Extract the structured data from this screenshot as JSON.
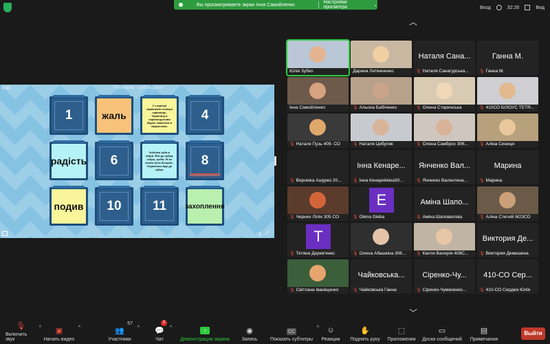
{
  "top": {
    "banner_text": "Вы просматриваете экран Інна Самойленко",
    "view_options": "Настройки просмотра",
    "login": "Вход",
    "time": "32:26",
    "view": "Вид"
  },
  "screen": {
    "timer": "0:30",
    "faint_title": "Тренируем - шоб выдрати",
    "tiles": [
      {
        "text": "1",
        "style": "dark"
      },
      {
        "text": "жаль",
        "style": "orange"
      },
      {
        "text": "У сторінки чарівників четверо чарівниць. Чарівниці в чарівницьктиви Відніх знаютися в мафиетами.",
        "style": "yellow-small"
      },
      {
        "text": "4",
        "style": "dark"
      },
      {
        "text": "радість",
        "style": "cyan"
      },
      {
        "text": "6",
        "style": "dark"
      },
      {
        "text": "Зобоїлм зуби в зебри. Йти до зубра, зебра, треба. Ні не хочеш бути беззубв - Лікуватися йди до зубра.",
        "style": "cyan-small"
      },
      {
        "text": "8",
        "style": "dark-underline"
      },
      {
        "text": "подив",
        "style": "yellow"
      },
      {
        "text": "10",
        "style": "dark"
      },
      {
        "text": "11",
        "style": "dark"
      },
      {
        "text": "захоплення",
        "style": "green"
      }
    ]
  },
  "participants": [
    {
      "name": "Юлія Зубко",
      "big": "",
      "kind": "photo",
      "bg": "#b9c7d6",
      "face": "#e3b48f",
      "muted": false,
      "active": true,
      "hand": true
    },
    {
      "name": "Дарина Литвиненко",
      "big": "",
      "kind": "photo",
      "bg": "#c8b8a2",
      "face": "#f0cfa3",
      "muted": false,
      "active": false
    },
    {
      "name": "Наталя Санагурська...",
      "big": "Наталя Сана...",
      "kind": "text",
      "muted": true
    },
    {
      "name": "Ганна М.",
      "big": "Ганна М.",
      "kind": "text",
      "muted": true
    },
    {
      "name": "Інна Самойленко",
      "big": "",
      "kind": "photo",
      "bg": "#6e5a4b",
      "face": "#d6a27f",
      "muted": false
    },
    {
      "name": "Альона Бабіченко",
      "big": "",
      "kind": "photo",
      "bg": "#b7a18a",
      "face": "#caa48a",
      "muted": true
    },
    {
      "name": "Олена Старинська",
      "big": "",
      "kind": "photo",
      "bg": "#d9cbb3",
      "face": "#f0d8b8",
      "muted": true
    },
    {
      "name": "410СО БІЛОУС ТЕТЯ...",
      "big": "",
      "kind": "photo",
      "bg": "#cfcfd3",
      "face": "#e2b98f",
      "muted": true
    },
    {
      "name": "Наталя Пузь 409- СО",
      "big": "",
      "kind": "photo",
      "bg": "#3a3a3a",
      "face": "#e0a86b",
      "muted": true
    },
    {
      "name": "Наталя Цибуляк",
      "big": "",
      "kind": "photo",
      "bg": "#c7cbd0",
      "face": "#d7b49a",
      "muted": true
    },
    {
      "name": "Олена Самброс 306...",
      "big": "",
      "kind": "photo",
      "bg": "#cfc7bf",
      "face": "#d8b39a",
      "muted": true
    },
    {
      "name": "Аліна Синиця",
      "big": "",
      "kind": "photo",
      "bg": "#b7a07c",
      "face": "#e9c79b",
      "muted": true
    },
    {
      "name": "Вероніка Ашурко 20...",
      "big": "",
      "kind": "blank",
      "muted": true
    },
    {
      "name": "Інна Кенарейкіна30...",
      "big": "Інна Кенаре...",
      "kind": "text",
      "muted": true
    },
    {
      "name": "Янченко Валентина...",
      "big": "Янченко Вал...",
      "kind": "text",
      "muted": true
    },
    {
      "name": "Марина",
      "big": "Марина",
      "kind": "text",
      "muted": true
    },
    {
      "name": "Черних Лілія 305 СО",
      "big": "",
      "kind": "photo",
      "bg": "#5b3b2c",
      "face": "#d2643a",
      "muted": true
    },
    {
      "name": "Olena Gleba",
      "big": "",
      "kind": "avatar",
      "letter": "E",
      "color": "#6a2fc1",
      "muted": true
    },
    {
      "name": "Аміна Шаповалова",
      "big": "Аміна Шапо...",
      "kind": "text",
      "muted": true
    },
    {
      "name": "Аліна Стегній М23СО",
      "big": "",
      "kind": "photo",
      "bg": "#6b5a48",
      "face": "#caa07a",
      "muted": true
    },
    {
      "name": "Тетяна Дерев'янко",
      "big": "",
      "kind": "avatar",
      "letter": "T",
      "color": "#6a2fc1",
      "muted": true
    },
    {
      "name": "Олена Абашкіна 308...",
      "big": "",
      "kind": "photo",
      "bg": "#2f2f2f",
      "face": "#e5c3a8",
      "muted": true
    },
    {
      "name": "Капля Валерія 408С...",
      "big": "",
      "kind": "photo",
      "bg": "#c0b4a5",
      "face": "#e7c6a6",
      "muted": true
    },
    {
      "name": "Виктория Демешина",
      "big": "Виктория Де...",
      "kind": "text",
      "muted": true
    },
    {
      "name": "Світлана Іваніщенко",
      "big": "",
      "kind": "photo",
      "bg": "#3b5f3a",
      "face": "#e7a46e",
      "muted": true
    },
    {
      "name": "Чайковська Ганна",
      "big": "Чайковська...",
      "kind": "text",
      "muted": true
    },
    {
      "name": "Сіренко-Чумаченко...",
      "big": "Сіренко-Чу...",
      "kind": "text",
      "muted": true
    },
    {
      "name": "410-СО Сердюк Юлія",
      "big": "410-СО Сер...",
      "kind": "text",
      "muted": true
    }
  ],
  "toolbar": {
    "mute": "Включить звук",
    "video": "Начать видео",
    "participants": "Участники",
    "participants_count": "57",
    "chat": "Чат",
    "chat_badge": "3",
    "share": "Демонстрация экрана",
    "record": "Запись",
    "captions": "Показать субтитры",
    "reactions": "Реакции",
    "raise_hand": "Поднять руку",
    "apps": "Приложения",
    "whiteboards": "Доски сообщений",
    "notes": "Примечания",
    "leave": "Выйти"
  }
}
